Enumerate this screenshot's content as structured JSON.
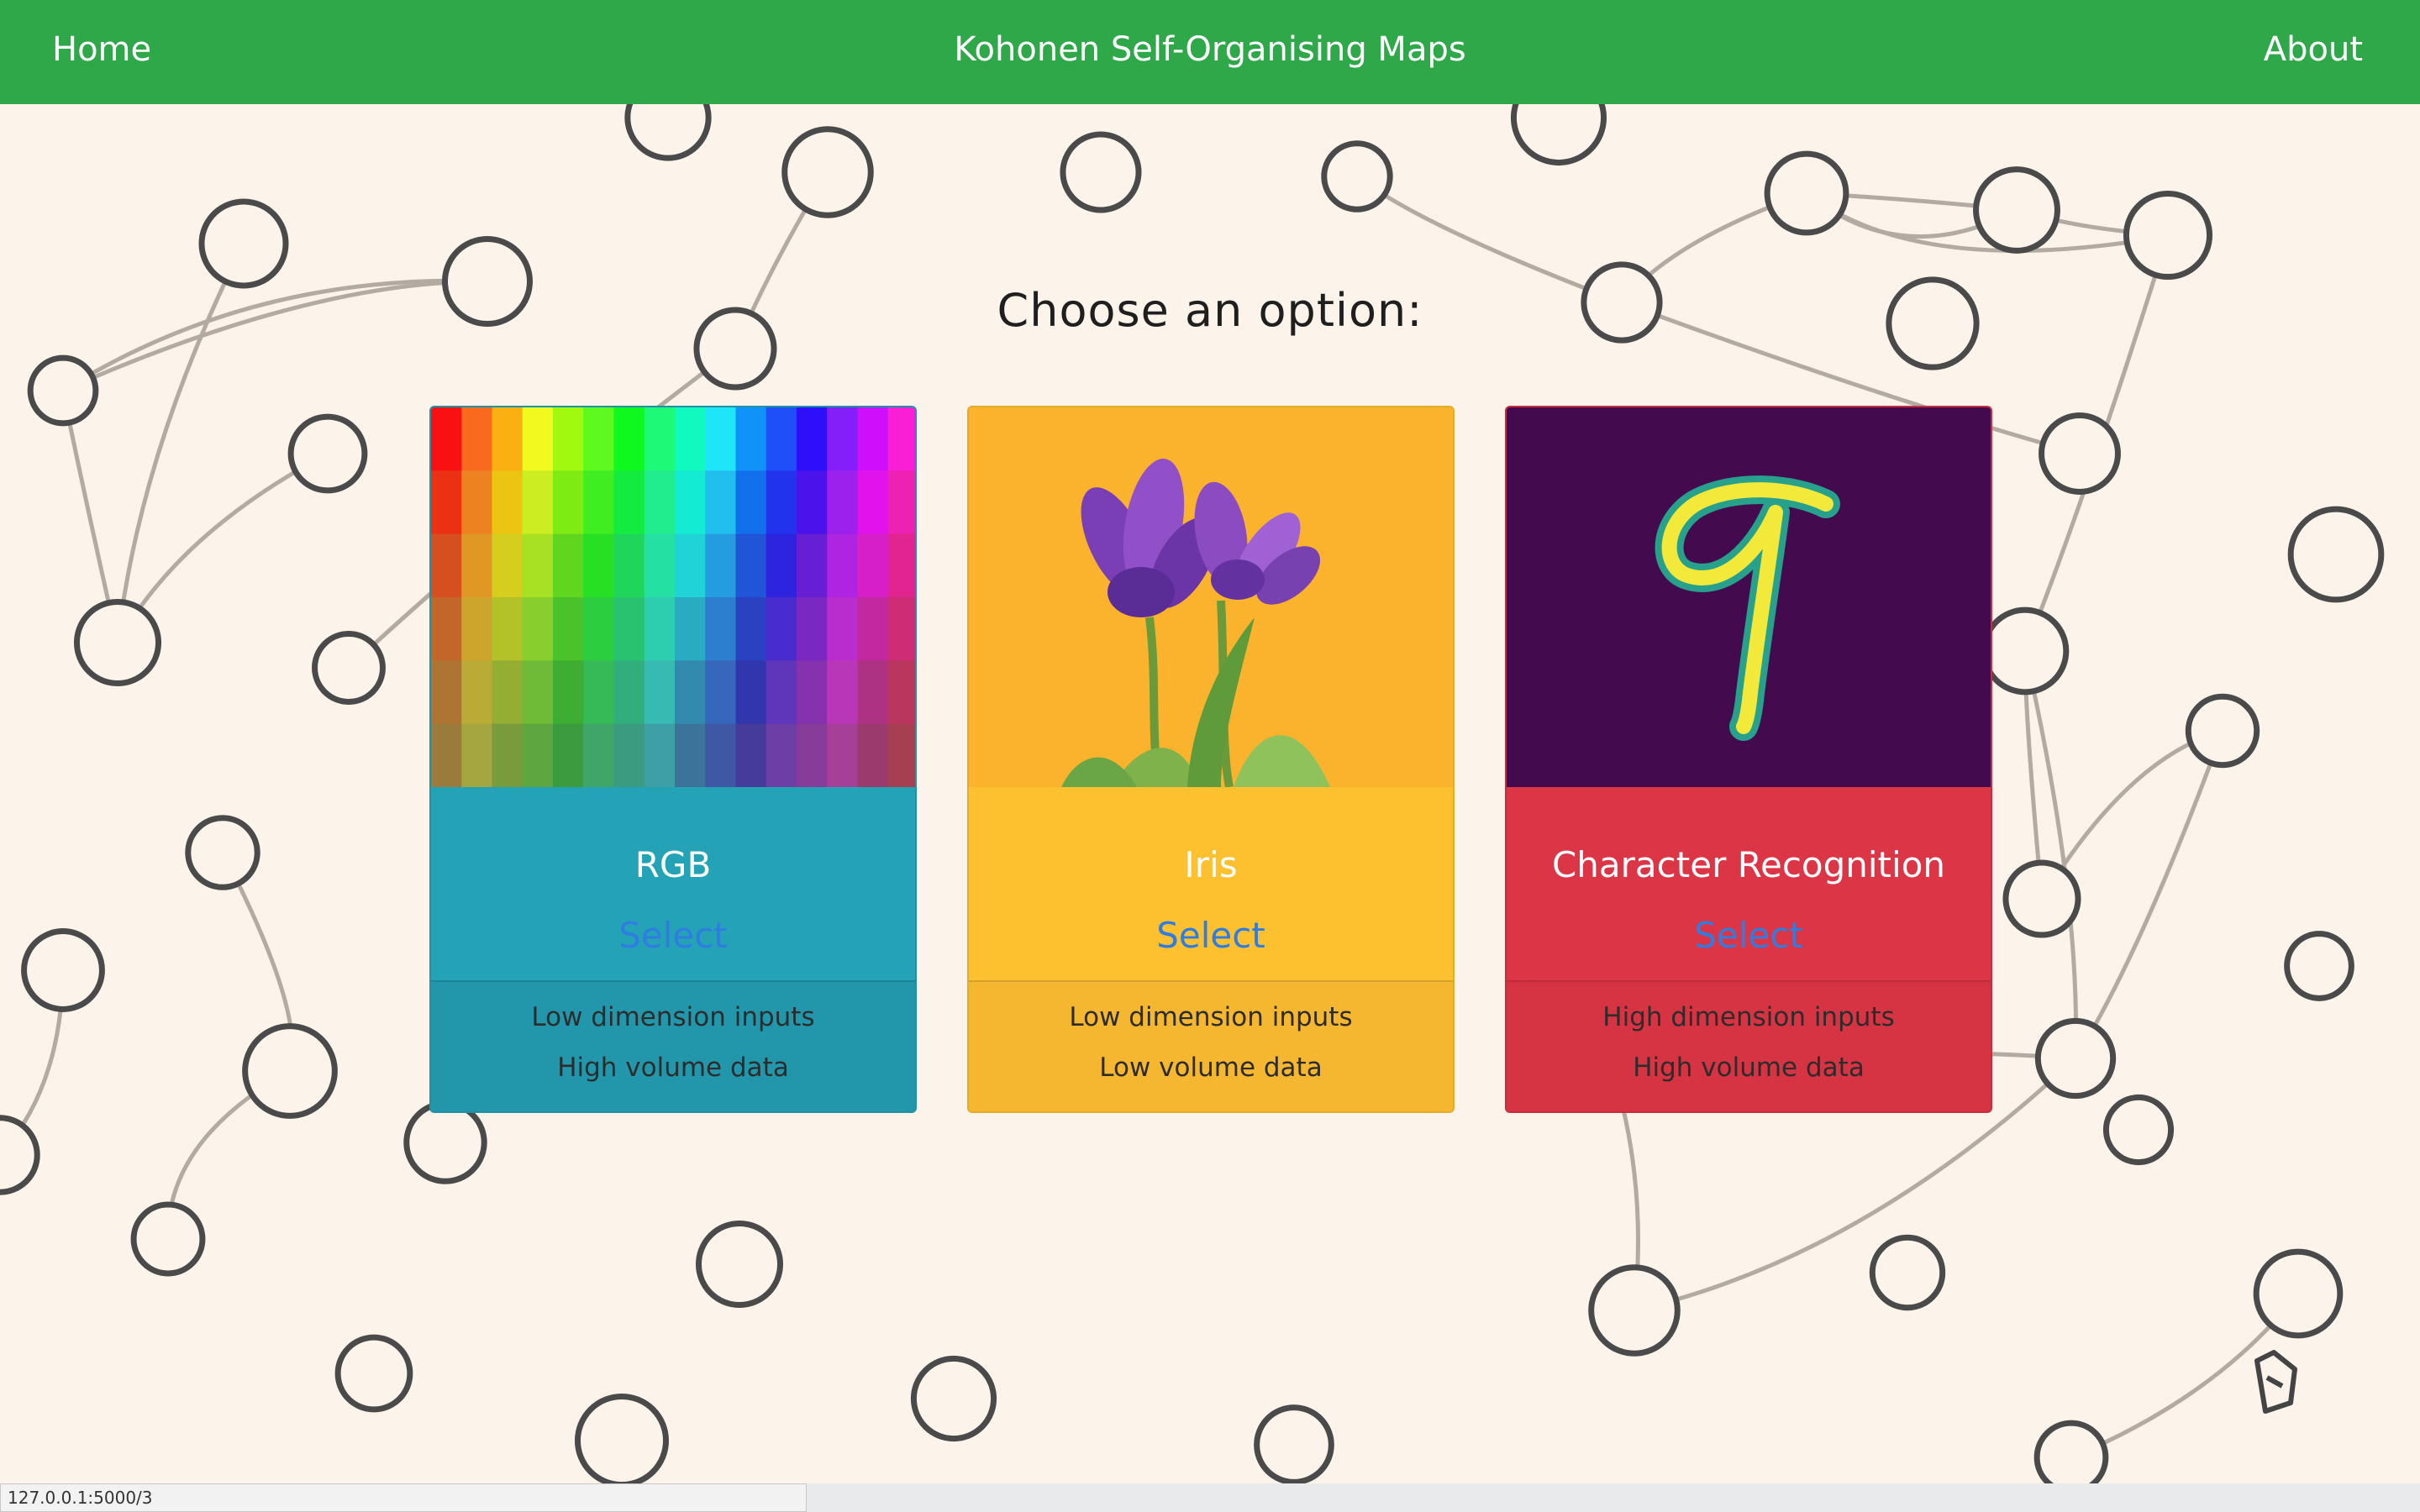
{
  "nav": {
    "home": "Home",
    "title": "Kohonen Self-Organising Maps",
    "about": "About"
  },
  "heading": "Choose an option:",
  "cards": [
    {
      "title": "RGB",
      "select_label": "Select",
      "line1": "Low dimension inputs",
      "line2": "High volume data",
      "color": "#24a3b7",
      "image": "rgb-color-grid"
    },
    {
      "title": "Iris",
      "select_label": "Select",
      "line1": "Low dimension inputs",
      "line2": "Low volume data",
      "color": "#fdc12f",
      "image": "iris-flower"
    },
    {
      "title": "Character Recognition",
      "select_label": "Select",
      "line1": "High dimension inputs",
      "line2": "High volume data",
      "color": "#dc3545",
      "image": "handwritten-digit-9"
    }
  ],
  "status_url": "127.0.0.1:5000/3",
  "colors": {
    "navbar": "#2fa84a",
    "background": "#fcf3ea",
    "link": "#2f7de1"
  }
}
